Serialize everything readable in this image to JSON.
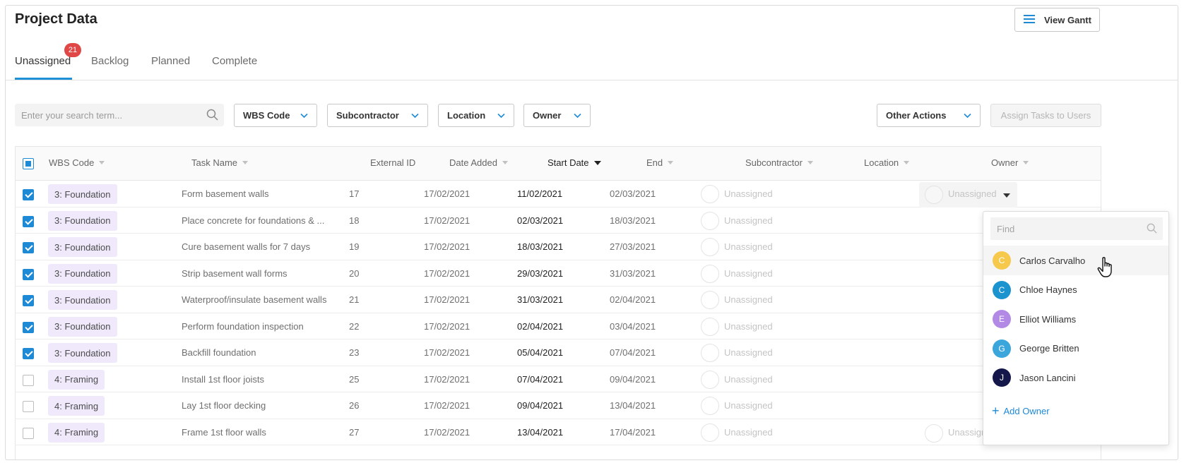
{
  "page": {
    "title": "Project Data",
    "view_gantt_label": "View Gantt"
  },
  "tabs": [
    {
      "label": "Unassigned",
      "active": true,
      "badge": "21"
    },
    {
      "label": "Backlog",
      "active": false
    },
    {
      "label": "Planned",
      "active": false
    },
    {
      "label": "Complete",
      "active": false
    }
  ],
  "toolbar": {
    "search_placeholder": "Enter your search term...",
    "filters": [
      "WBS Code",
      "Subcontractor",
      "Location",
      "Owner"
    ],
    "other_actions_label": "Other Actions",
    "assign_label": "Assign Tasks to Users"
  },
  "columns": [
    "WBS Code",
    "Task Name",
    "External ID",
    "Date Added",
    "Start Date",
    "End",
    "Subcontractor",
    "Location",
    "Owner"
  ],
  "sorted_column": "Start Date",
  "rows": [
    {
      "checked": true,
      "wbs": "3: Foundation",
      "task": "Form basement walls",
      "ext_id": "17",
      "added": "17/02/2021",
      "start": "11/02/2021",
      "end": "02/03/2021",
      "subcontractor": "Unassigned",
      "owner": "Unassigned"
    },
    {
      "checked": true,
      "wbs": "3: Foundation",
      "task": "Place concrete for foundations & ...",
      "ext_id": "18",
      "added": "17/02/2021",
      "start": "02/03/2021",
      "end": "18/03/2021",
      "subcontractor": "Unassigned",
      "owner": ""
    },
    {
      "checked": true,
      "wbs": "3: Foundation",
      "task": "Cure basement walls for 7 days",
      "ext_id": "19",
      "added": "17/02/2021",
      "start": "18/03/2021",
      "end": "27/03/2021",
      "subcontractor": "Unassigned",
      "owner": ""
    },
    {
      "checked": true,
      "wbs": "3: Foundation",
      "task": "Strip basement wall forms",
      "ext_id": "20",
      "added": "17/02/2021",
      "start": "29/03/2021",
      "end": "31/03/2021",
      "subcontractor": "Unassigned",
      "owner": ""
    },
    {
      "checked": true,
      "wbs": "3: Foundation",
      "task": "Waterproof/insulate basement walls",
      "ext_id": "21",
      "added": "17/02/2021",
      "start": "31/03/2021",
      "end": "02/04/2021",
      "subcontractor": "Unassigned",
      "owner": ""
    },
    {
      "checked": true,
      "wbs": "3: Foundation",
      "task": "Perform foundation inspection",
      "ext_id": "22",
      "added": "17/02/2021",
      "start": "02/04/2021",
      "end": "03/04/2021",
      "subcontractor": "Unassigned",
      "owner": ""
    },
    {
      "checked": true,
      "wbs": "3: Foundation",
      "task": "Backfill foundation",
      "ext_id": "23",
      "added": "17/02/2021",
      "start": "05/04/2021",
      "end": "07/04/2021",
      "subcontractor": "Unassigned",
      "owner": ""
    },
    {
      "checked": false,
      "wbs": "4: Framing",
      "task": "Install 1st floor joists",
      "ext_id": "25",
      "added": "17/02/2021",
      "start": "07/04/2021",
      "end": "09/04/2021",
      "subcontractor": "Unassigned",
      "owner": ""
    },
    {
      "checked": false,
      "wbs": "4: Framing",
      "task": "Lay 1st floor decking",
      "ext_id": "26",
      "added": "17/02/2021",
      "start": "09/04/2021",
      "end": "13/04/2021",
      "subcontractor": "Unassigned",
      "owner": ""
    },
    {
      "checked": false,
      "wbs": "4: Framing",
      "task": "Frame 1st floor walls",
      "ext_id": "27",
      "added": "17/02/2021",
      "start": "13/04/2021",
      "end": "17/04/2021",
      "subcontractor": "Unassigned",
      "owner": "Unassigned"
    }
  ],
  "owner_dropdown": {
    "find_placeholder": "Find",
    "items": [
      {
        "initial": "C",
        "name": "Carlos Carvalho",
        "color": "#f6c84c"
      },
      {
        "initial": "C",
        "name": "Chloe Haynes",
        "color": "#1a93cf"
      },
      {
        "initial": "E",
        "name": "Elliot Williams",
        "color": "#b28ae6"
      },
      {
        "initial": "G",
        "name": "George Britten",
        "color": "#3aa6dc"
      },
      {
        "initial": "J",
        "name": "Jason Lancini",
        "color": "#14174a"
      }
    ],
    "add_label": "Add Owner"
  },
  "colors": {
    "accent": "#1e8ad6",
    "badge": "#e04848",
    "wbs_chip": "#efe9fb"
  },
  "icons": [
    "hamburger-icon",
    "search-icon",
    "chevron-down-icon",
    "hand-pointer-icon",
    "plus-icon"
  ]
}
